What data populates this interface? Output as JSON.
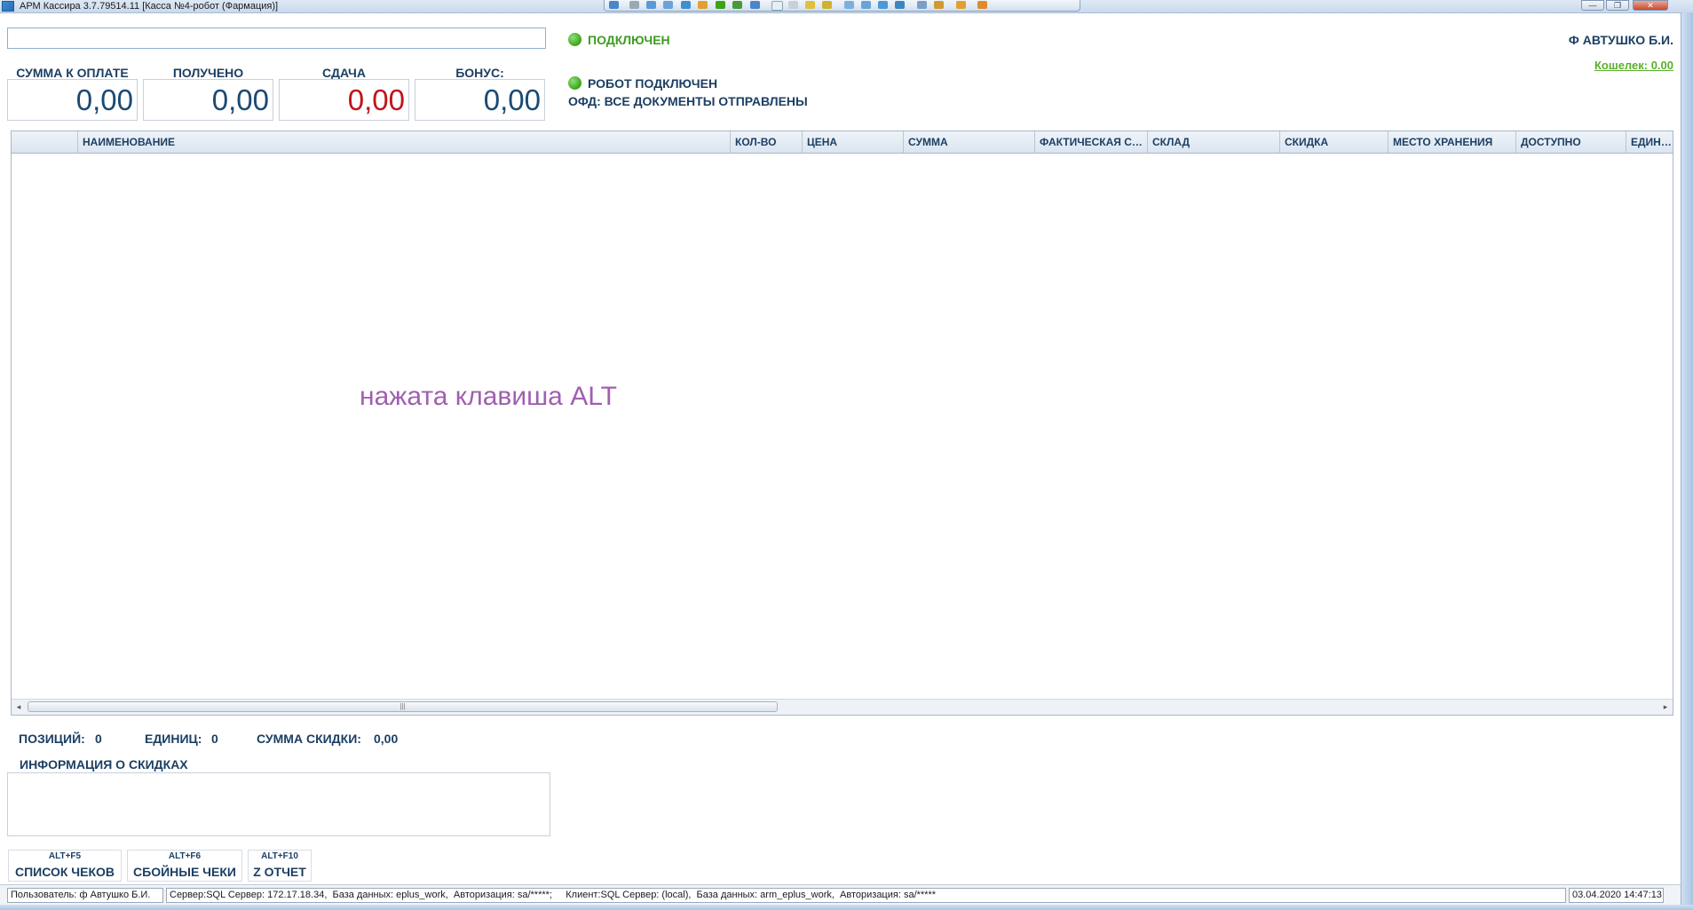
{
  "window": {
    "title": "АРМ Кассира 3.7.79514.11 [Касса №4-робот (Фармация)]",
    "controls": {
      "minimize": "—",
      "maximize": "❐",
      "close": "✕"
    }
  },
  "search": {
    "value": "",
    "placeholder": ""
  },
  "amounts": [
    {
      "label": "СУММА К ОПЛАТЕ",
      "value": "0,00"
    },
    {
      "label": "ПОЛУЧЕНО",
      "value": "0,00"
    },
    {
      "label": "СДАЧА",
      "value": "0,00"
    },
    {
      "label": "БОНУС:",
      "value": "0,00"
    }
  ],
  "status": {
    "connection": "ПОДКЛЮЧЕН",
    "robot": "РОБОТ ПОДКЛЮЧЕН",
    "ofd": "ОФД: ВСЕ ДОКУМЕНТЫ ОТПРАВЛЕНЫ",
    "indicator_color": "#3aa317"
  },
  "user": {
    "name": "Ф АВТУШКО Б.И.",
    "wallet": "Кошелек: 0.00"
  },
  "grid": {
    "columns": [
      "",
      "НАИМЕНОВАНИЕ",
      "КОЛ-ВО",
      "ЦЕНА",
      "СУММА",
      "ФАКТИЧЕСКАЯ СК...",
      "СКЛАД",
      "СКИДКА",
      "МЕСТО ХРАНЕНИЯ",
      "ДОСТУПНО",
      "ЕДИНИЦ"
    ],
    "rows": [],
    "overlay_message": "нажата клавиша ALT",
    "scroll_thumb_grip": "|||"
  },
  "summary": {
    "positions_label": "ПОЗИЦИЙ:",
    "positions": "0",
    "units_label": "ЕДИНИЦ:",
    "units": "0",
    "discount_sum_label": "СУММА СКИДКИ:",
    "discount_sum": "0,00"
  },
  "discount_info": {
    "title": "ИНФОРМАЦИЯ О СКИДКАХ",
    "text": ""
  },
  "actions": [
    {
      "hotkey": "ALT+F5",
      "label": "СПИСОК ЧЕКОВ"
    },
    {
      "hotkey": "ALT+F6",
      "label": "СБОЙНЫЕ ЧЕКИ"
    },
    {
      "hotkey": "ALT+F10",
      "label": "Z ОТЧЕТ"
    }
  ],
  "statusbar": {
    "user": "Пользователь: ф Автушко Б.И.",
    "server": "Сервер:SQL Сервер: 172.17.18.34,  База данных: eplus_work,  Авторизация: sa/*****;     Клиент:SQL Сервер: (local),  База данных: arm_eplus_work,  Авторизация: sa/*****",
    "datetime": "03.04.2020 14:47:13"
  },
  "colors": {
    "accent": "#1c3f63",
    "change_amount": "#c0141c",
    "overlay": "#a05fb0",
    "wallet": "#5bb02c"
  }
}
